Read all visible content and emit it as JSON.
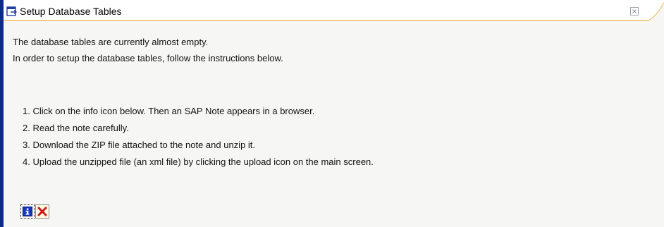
{
  "dialog": {
    "title": "Setup Database Tables",
    "intro": [
      "The database tables are currently almost empty.",
      "In order to setup the database tables, follow the instructions below."
    ],
    "steps": [
      "1. Click on the info icon below. Then an SAP Note appears in a browser.",
      "2. Read the note carefully.",
      "3. Download the ZIP file attached to the note and unzip it.",
      "4. Upload the unzipped file (an xml file) by clicking the upload icon on the main screen."
    ]
  },
  "icons": {
    "title": "dialog-window-icon",
    "close": "close-icon",
    "info": "info-icon",
    "cancel": "cancel-icon"
  },
  "colors": {
    "frame_blue": "#0c2a8a",
    "title_accent": "#f0a020",
    "background": "#f6f7f5",
    "info_blue": "#1635c4",
    "cancel_red": "#cc1b1b"
  }
}
